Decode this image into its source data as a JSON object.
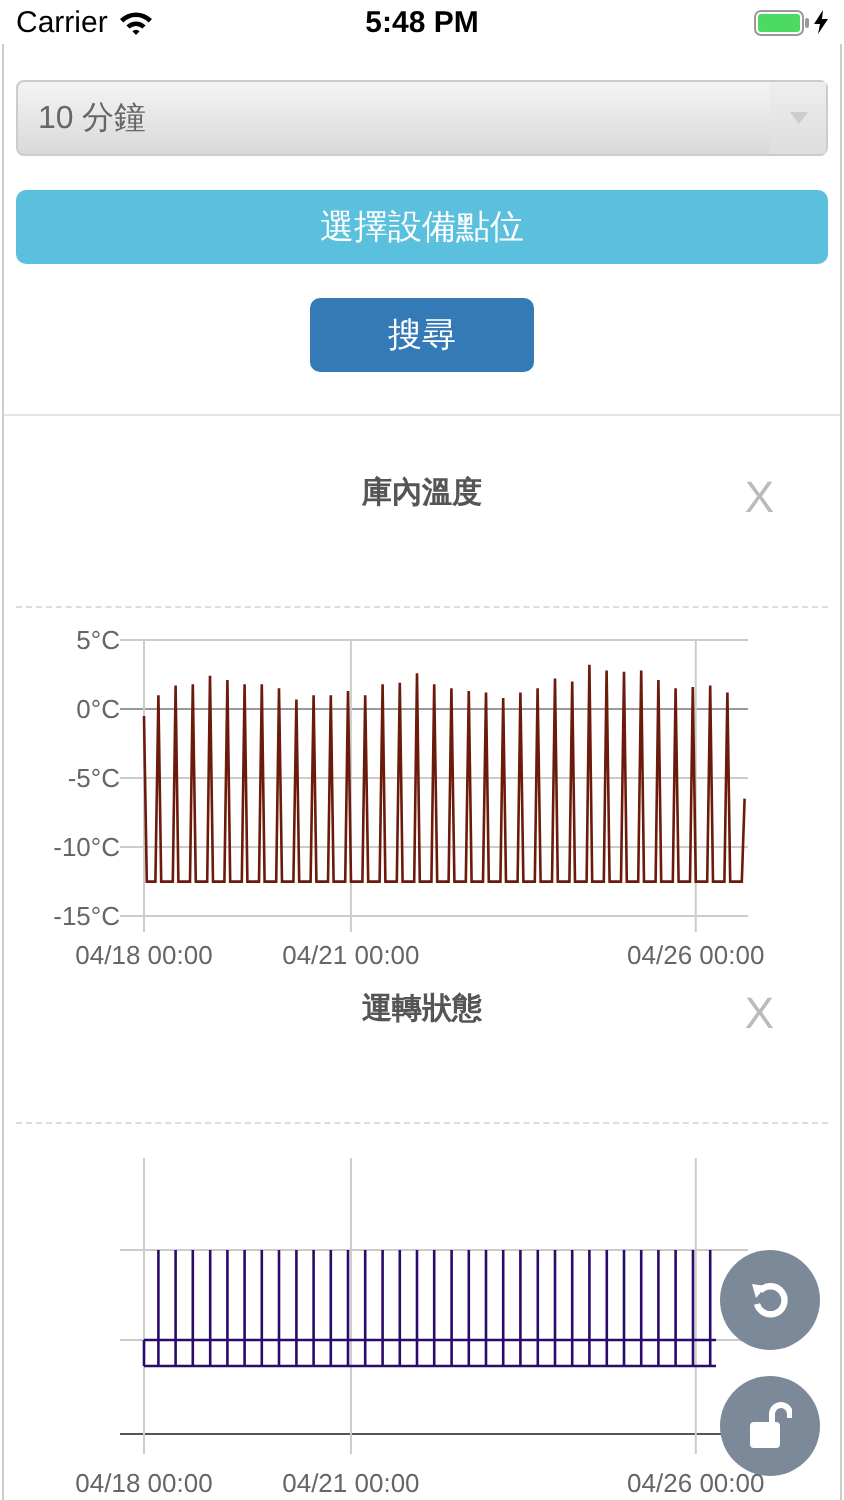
{
  "status_bar": {
    "carrier": "Carrier",
    "time": "5:48 PM"
  },
  "filter": {
    "interval": "10 分鐘",
    "select_button": "選擇設備點位",
    "search_button": "搜尋"
  },
  "charts": [
    {
      "title": "庫內溫度",
      "close": "X",
      "chart_data": {
        "type": "line",
        "ylim": [
          -15,
          5
        ],
        "yticks": [
          {
            "value": 5,
            "label": "5°C"
          },
          {
            "value": 0,
            "label": "0°C"
          },
          {
            "value": -5,
            "label": "-5°C"
          },
          {
            "value": -10,
            "label": "-10°C"
          },
          {
            "value": -15,
            "label": "-15°C"
          }
        ],
        "categories": [
          "04/18 00:00",
          null,
          null,
          null,
          null,
          null,
          null,
          null,
          null,
          null,
          null,
          null,
          null,
          null,
          null,
          null,
          null,
          null,
          null,
          null,
          null,
          null,
          null,
          null,
          null,
          null,
          null,
          null,
          null,
          null,
          null,
          null,
          null,
          null,
          null,
          null,
          null,
          null,
          null,
          null,
          null,
          null,
          null,
          null,
          null,
          null,
          null,
          null,
          null,
          null,
          null,
          null,
          null,
          null,
          null,
          null,
          null,
          null,
          null,
          null,
          null,
          null,
          null,
          null,
          null,
          null,
          null,
          null,
          null,
          null,
          null,
          null,
          "04/21 00:00",
          null,
          null,
          null,
          null,
          null,
          null,
          null,
          null,
          null,
          null,
          null,
          null,
          null,
          null,
          null,
          null,
          null,
          null,
          null,
          null,
          null,
          null,
          null,
          null,
          null,
          null,
          null,
          null,
          null,
          null,
          null,
          null,
          null,
          null,
          null,
          null,
          null,
          null,
          null,
          null,
          null,
          null,
          null,
          null,
          null,
          null,
          null,
          null,
          null,
          null,
          null,
          null,
          null,
          null,
          null,
          null,
          null,
          null,
          null,
          null,
          null,
          null,
          null,
          null,
          null,
          null,
          null,
          null,
          null,
          null,
          null,
          null,
          null,
          null,
          null,
          null,
          null,
          null,
          null,
          null,
          null,
          null,
          null,
          null,
          null,
          null,
          null,
          null,
          null,
          null,
          null,
          null,
          null,
          null,
          null,
          null,
          null,
          null,
          null,
          null,
          null,
          null,
          null,
          null,
          null,
          null,
          null,
          null,
          null,
          null,
          null,
          null,
          null,
          null,
          null,
          null,
          null,
          null,
          null,
          "04/26 00:00",
          null,
          null,
          null,
          null,
          null,
          null,
          null,
          null,
          null,
          null,
          null,
          null,
          null,
          null,
          null,
          null,
          null
        ],
        "series": [
          {
            "color": "#6b1a0c",
            "values": [
              -0.5,
              -12.5,
              -12.5,
              -12.5,
              -12.5,
              1.0,
              -12.5,
              -12.5,
              -12.5,
              -12.5,
              -12.5,
              1.7,
              -12.5,
              -12.5,
              -12.5,
              -12.5,
              -12.5,
              1.8,
              -12.5,
              -12.5,
              -12.5,
              -12.5,
              -12.5,
              2.4,
              -12.5,
              -12.5,
              -12.5,
              -12.5,
              -12.5,
              2.1,
              -12.5,
              -12.5,
              -12.5,
              -12.5,
              -12.5,
              1.8,
              -12.5,
              -12.5,
              -12.5,
              -12.5,
              -12.5,
              1.8,
              -12.5,
              -12.5,
              -12.5,
              -12.5,
              -12.5,
              1.5,
              -12.5,
              -12.5,
              -12.5,
              -12.5,
              -12.5,
              0.7,
              -12.5,
              -12.5,
              -12.5,
              -12.5,
              -12.5,
              1.0,
              -12.5,
              -12.5,
              -12.5,
              -12.5,
              -12.5,
              1.0,
              -12.5,
              -12.5,
              -12.5,
              -12.5,
              -12.5,
              1.3,
              -12.5,
              -12.5,
              -12.5,
              -12.5,
              -12.5,
              1.0,
              -12.5,
              -12.5,
              -12.5,
              -12.5,
              -12.5,
              1.8,
              -12.5,
              -12.5,
              -12.5,
              -12.5,
              -12.5,
              1.9,
              -12.5,
              -12.5,
              -12.5,
              -12.5,
              -12.5,
              2.6,
              -12.5,
              -12.5,
              -12.5,
              -12.5,
              -12.5,
              1.8,
              -12.5,
              -12.5,
              -12.5,
              -12.5,
              -12.5,
              1.5,
              -12.5,
              -12.5,
              -12.5,
              -12.5,
              -12.5,
              1.3,
              -12.5,
              -12.5,
              -12.5,
              -12.5,
              -12.5,
              1.2,
              -12.5,
              -12.5,
              -12.5,
              -12.5,
              -12.5,
              0.8,
              -12.5,
              -12.5,
              -12.5,
              -12.5,
              -12.5,
              1.2,
              -12.5,
              -12.5,
              -12.5,
              -12.5,
              -12.5,
              1.5,
              -12.5,
              -12.5,
              -12.5,
              -12.5,
              -12.5,
              2.2,
              -12.5,
              -12.5,
              -12.5,
              -12.5,
              -12.5,
              2.0,
              -12.5,
              -12.5,
              -12.5,
              -12.5,
              -12.5,
              3.2,
              -12.5,
              -12.5,
              -12.5,
              -12.5,
              -12.5,
              2.8,
              -12.5,
              -12.5,
              -12.5,
              -12.5,
              -12.5,
              2.7,
              -12.5,
              -12.5,
              -12.5,
              -12.5,
              -12.5,
              2.8,
              -12.5,
              -12.5,
              -12.5,
              -12.5,
              -12.5,
              2.1,
              -12.5,
              -12.5,
              -12.5,
              -12.5,
              -12.5,
              1.5,
              -12.5,
              -12.5,
              -12.5,
              -12.5,
              -12.5,
              1.6,
              -12.5,
              -12.5,
              -12.5,
              -12.5,
              -12.5,
              1.7,
              -12.5,
              -12.5,
              -12.5,
              -12.5,
              -12.5,
              1.2,
              -12.5,
              -12.5,
              -12.5,
              -12.5,
              -12.5,
              -6.5
            ]
          }
        ]
      }
    },
    {
      "title": "運轉狀態",
      "close": "X",
      "x_labels": [
        "04/18 00:00",
        "04/21 00:00",
        "04/26 00:00"
      ]
    }
  ]
}
